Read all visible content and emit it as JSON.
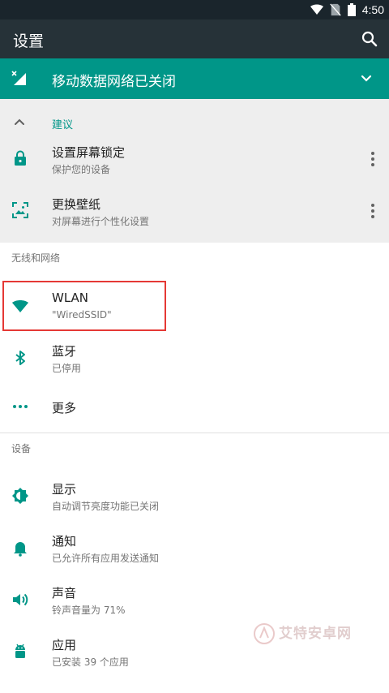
{
  "status_bar": {
    "time": "4:50"
  },
  "app_bar": {
    "title": "设置",
    "search_icon": "search-icon"
  },
  "banner": {
    "text": "移动数据网络已关闭",
    "icon": "mobile-data-off-icon",
    "color": "#009688"
  },
  "suggestions": {
    "header": "建议",
    "items": [
      {
        "title": "设置屏幕锁定",
        "subtitle": "保护您的设备",
        "icon": "lock-icon"
      },
      {
        "title": "更换壁纸",
        "subtitle": "对屏幕进行个性化设置",
        "icon": "wallpaper-icon"
      }
    ]
  },
  "sections": [
    {
      "label": "无线和网络",
      "items": [
        {
          "title": "WLAN",
          "subtitle": "\"WiredSSID\"",
          "icon": "wifi-icon"
        },
        {
          "title": "蓝牙",
          "subtitle": "已停用",
          "icon": "bluetooth-icon"
        },
        {
          "title": "更多",
          "subtitle": "",
          "icon": "more-horiz-icon"
        }
      ]
    },
    {
      "label": "设备",
      "items": [
        {
          "title": "显示",
          "subtitle": "自动调节亮度功能已关闭",
          "icon": "brightness-icon"
        },
        {
          "title": "通知",
          "subtitle": "已允许所有应用发送通知",
          "icon": "bell-icon"
        },
        {
          "title": "声音",
          "subtitle": "铃声音量为 71%",
          "icon": "volume-icon"
        },
        {
          "title": "应用",
          "subtitle": "已安装 39 个应用",
          "icon": "android-icon"
        }
      ]
    }
  ],
  "watermark": {
    "text": "艾特安卓网"
  },
  "colors": {
    "accent": "#009688",
    "app_bar": "#263238",
    "status_bar": "#1a252c",
    "highlight": "#e53935"
  }
}
